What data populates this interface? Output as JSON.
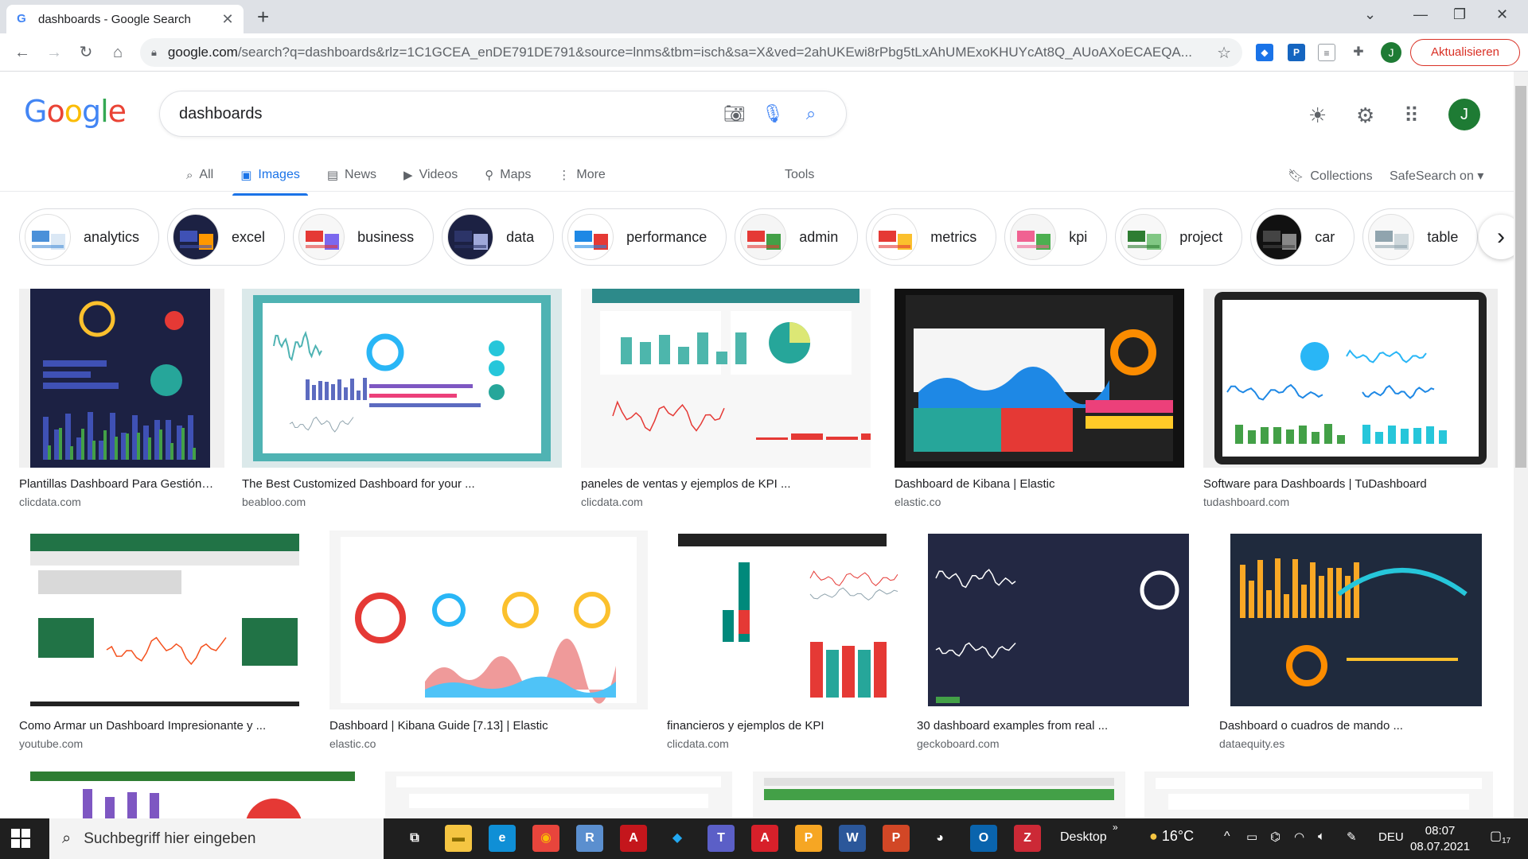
{
  "browser": {
    "tab_title": "dashboards - Google Search",
    "url_host": "google.com",
    "url_rest": "/search?q=dashboards&rlz=1C1GCEA_enDE791DE791&source=lnms&tbm=isch&sa=X&ved=2ahUKEwi8rPbg5tLxAhUMExoKHUYcAt8Q_AUoAXoECAEQA...",
    "update_label": "Aktualisieren",
    "profile_initial": "J"
  },
  "google": {
    "logo": [
      "G",
      "o",
      "o",
      "g",
      "l",
      "e"
    ],
    "query": "dashboards",
    "avatar_initial": "J",
    "tabs": [
      {
        "icon": "search-icon",
        "glyph": "⌕",
        "label": "All"
      },
      {
        "icon": "image-icon",
        "glyph": "▣",
        "label": "Images"
      },
      {
        "icon": "news-icon",
        "glyph": "▤",
        "label": "News"
      },
      {
        "icon": "video-icon",
        "glyph": "▶",
        "label": "Videos"
      },
      {
        "icon": "map-pin-icon",
        "glyph": "⚲",
        "label": "Maps"
      },
      {
        "icon": "more-vert-icon",
        "glyph": "⋮",
        "label": "More"
      }
    ],
    "active_tab": "Images",
    "tools_label": "Tools",
    "collections_label": "Collections",
    "safesearch_label": "SafeSearch on"
  },
  "chips": [
    {
      "label": "analytics",
      "colors": [
        "#ffffff",
        "#4a90d9",
        "#dbe8f5"
      ]
    },
    {
      "label": "excel",
      "colors": [
        "#1c2143",
        "#3f51b5",
        "#ff9800"
      ]
    },
    {
      "label": "business",
      "colors": [
        "#f7f7f7",
        "#e53935",
        "#7b68ee"
      ]
    },
    {
      "label": "data",
      "colors": [
        "#1c2143",
        "#2c3468",
        "#9fa8da"
      ]
    },
    {
      "label": "performance",
      "colors": [
        "#ffffff",
        "#1e88e5",
        "#e53935"
      ]
    },
    {
      "label": "admin",
      "colors": [
        "#f5f5f5",
        "#e53935",
        "#43a047"
      ]
    },
    {
      "label": "metrics",
      "colors": [
        "#ffffff",
        "#e53935",
        "#fbc02d"
      ]
    },
    {
      "label": "kpi",
      "colors": [
        "#f5f5f5",
        "#f06292",
        "#4caf50"
      ]
    },
    {
      "label": "project",
      "colors": [
        "#f8f8f8",
        "#2e7d32",
        "#81c784"
      ]
    },
    {
      "label": "car",
      "colors": [
        "#111111",
        "#444444",
        "#888888"
      ]
    },
    {
      "label": "table",
      "colors": [
        "#f8f8f8",
        "#90a4ae",
        "#cfd8dc"
      ]
    }
  ],
  "results": [
    {
      "title": "Plantillas Dashboard Para Gestión…",
      "source": "clicdata.com",
      "theme": "dark-navy"
    },
    {
      "title": "The Best Customized Dashboard for your ...",
      "source": "beabloo.com",
      "theme": "teal-frame"
    },
    {
      "title": "paneles de ventas y ejemplos de KPI ...",
      "source": "clicdata.com",
      "theme": "light-teal"
    },
    {
      "title": "Dashboard de Kibana | Elastic",
      "source": "elastic.co",
      "theme": "kibana-dark"
    },
    {
      "title": "Software para Dashboards | TuDashboard",
      "source": "tudashboard.com",
      "theme": "tablet"
    },
    {
      "title": "Como Armar un Dashboard Impresionante y ...",
      "source": "youtube.com",
      "theme": "excel-green"
    },
    {
      "title": "Dashboard | Kibana Guide [7.13] | Elastic",
      "source": "elastic.co",
      "theme": "kibana-light"
    },
    {
      "title": "financieros y ejemplos de KPI",
      "source": "clicdata.com",
      "theme": "finance"
    },
    {
      "title": "30 dashboard examples from real ...",
      "source": "geckoboard.com",
      "theme": "gecko"
    },
    {
      "title": "Dashboard o cuadros de mando ...",
      "source": "dataequity.es",
      "theme": "dark-orange"
    },
    {
      "title": "",
      "source": "",
      "theme": "row3-green"
    },
    {
      "title": "",
      "source": "",
      "theme": "row3-grey"
    },
    {
      "title": "",
      "source": "",
      "theme": "row3-green2"
    },
    {
      "title": "",
      "source": "",
      "theme": "row3-light"
    }
  ],
  "taskbar": {
    "search_placeholder": "Suchbegriff hier eingeben",
    "desktop_label": "Desktop",
    "weather": "16°C",
    "language": "DEU",
    "time": "08:07",
    "date": "08.07.2021",
    "notifications": "17",
    "apps": [
      {
        "name": "task-view-icon",
        "glyph": "⧉",
        "bg": "transparent",
        "fg": "#ffffff"
      },
      {
        "name": "file-explorer-icon",
        "glyph": "▬",
        "bg": "#f5c542",
        "fg": "#8a6d00"
      },
      {
        "name": "edge-icon",
        "glyph": "e",
        "bg": "#0f8fd6",
        "fg": "#ffffff"
      },
      {
        "name": "chrome-icon",
        "glyph": "◉",
        "bg": "#e8453c",
        "fg": "#fbbc05"
      },
      {
        "name": "r-icon",
        "glyph": "R",
        "bg": "#5b8fcf",
        "fg": "#ffffff"
      },
      {
        "name": "acrobat-icon",
        "glyph": "A",
        "bg": "#c4161c",
        "fg": "#ffffff"
      },
      {
        "name": "vscode-icon",
        "glyph": "◆",
        "bg": "transparent",
        "fg": "#23a9f2"
      },
      {
        "name": "teams-icon",
        "glyph": "T",
        "bg": "#5b5fc7",
        "fg": "#ffffff"
      },
      {
        "name": "acrobat-reader-icon",
        "glyph": "A",
        "bg": "#d7202a",
        "fg": "#ffffff"
      },
      {
        "name": "power-bi-icon",
        "glyph": "P",
        "bg": "#f6a623",
        "fg": "#ffffff"
      },
      {
        "name": "word-icon",
        "glyph": "W",
        "bg": "#2b579a",
        "fg": "#ffffff"
      },
      {
        "name": "powerpoint-icon",
        "glyph": "P",
        "bg": "#d24726",
        "fg": "#ffffff"
      },
      {
        "name": "panda-icon",
        "glyph": "◕",
        "bg": "transparent",
        "fg": "#ffffff"
      },
      {
        "name": "outlook-icon",
        "glyph": "O",
        "bg": "#0a64ad",
        "fg": "#ffffff"
      },
      {
        "name": "zotero-icon",
        "glyph": "Z",
        "bg": "#cc2936",
        "fg": "#ffffff"
      }
    ]
  }
}
